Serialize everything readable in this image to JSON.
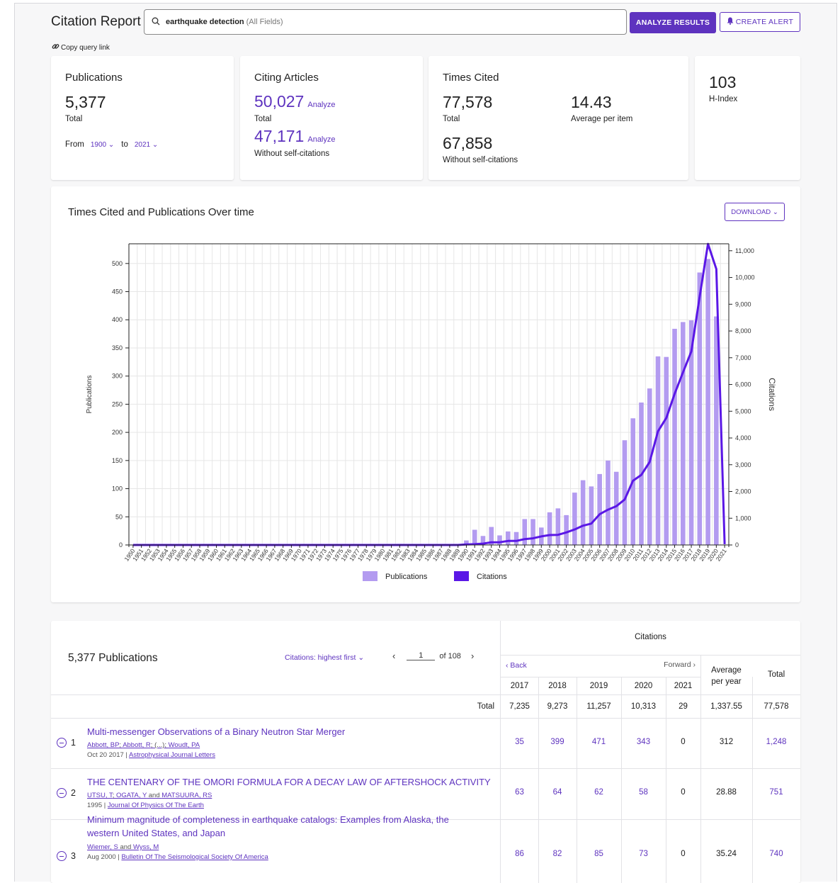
{
  "header": {
    "title": "Citation Report",
    "query": "earthquake detection",
    "field": "(All Fields)",
    "analyze_label": "ANALYZE RESULTS",
    "alert_label": "CREATE ALERT",
    "copy_link_label": "Copy query link"
  },
  "metrics": {
    "publications": {
      "title": "Publications",
      "value": "5,377",
      "sub": "Total",
      "from_label": "From",
      "from": "1900",
      "to_label": "to",
      "to": "2021"
    },
    "citing": {
      "title": "Citing Articles",
      "total": "50,027",
      "total_sub": "Total",
      "without": "47,171",
      "without_sub": "Without self-citations",
      "analyze": "Analyze"
    },
    "times_cited": {
      "title": "Times Cited",
      "total": "77,578",
      "total_sub": "Total",
      "avg": "14.43",
      "avg_sub": "Average per item",
      "without": "67,858",
      "without_sub": "Without self-citations"
    },
    "hindex": {
      "value": "103",
      "label": "H-Index"
    }
  },
  "chart": {
    "title": "Times Cited and Publications Over time",
    "download_label": "DOWNLOAD",
    "legend_pub": "Publications",
    "legend_cit": "Citations"
  },
  "chart_data": {
    "type": "bar",
    "title": "Times Cited and Publications Over time",
    "ylabel": "Publications",
    "y2label": "Citations",
    "ylim": [
      0,
      535
    ],
    "y2lim": [
      0,
      11260
    ],
    "yticks": [
      0,
      50,
      100,
      150,
      200,
      250,
      300,
      350,
      400,
      450,
      500
    ],
    "y2ticks": [
      0,
      1000,
      2000,
      3000,
      4000,
      5000,
      6000,
      7000,
      8000,
      9000,
      10000,
      11000
    ],
    "y2tick_labels": [
      "0",
      "1,000",
      "2,000",
      "3,000",
      "4,000",
      "5,000",
      "6,000",
      "7,000",
      "8,000",
      "9,000",
      "10,000",
      "11,000"
    ],
    "categories": [
      "1950",
      "1951",
      "1952",
      "1953",
      "1954",
      "1955",
      "1956",
      "1957",
      "1958",
      "1959",
      "1960",
      "1961",
      "1962",
      "1963",
      "1964",
      "1965",
      "1966",
      "1967",
      "1968",
      "1969",
      "1970",
      "1971",
      "1972",
      "1973",
      "1974",
      "1975",
      "1976",
      "1977",
      "1978",
      "1979",
      "1980",
      "1981",
      "1982",
      "1983",
      "1984",
      "1985",
      "1986",
      "1987",
      "1988",
      "1989",
      "1990",
      "1991",
      "1992",
      "1993",
      "1994",
      "1995",
      "1996",
      "1997",
      "1998",
      "1999",
      "2000",
      "2001",
      "2002",
      "2003",
      "2004",
      "2005",
      "2006",
      "2007",
      "2008",
      "2009",
      "2010",
      "2011",
      "2012",
      "2013",
      "2014",
      "2015",
      "2016",
      "2017",
      "2018",
      "2019",
      "2020",
      "2021"
    ],
    "series": [
      {
        "name": "Publications",
        "type": "bar",
        "axis": "left",
        "values": [
          0,
          0,
          0,
          0,
          0,
          0,
          0,
          0,
          0,
          0,
          0,
          0,
          0,
          1,
          0,
          0,
          0,
          0,
          0,
          0,
          0,
          1,
          0,
          0,
          0,
          0,
          0,
          0,
          0,
          0,
          1,
          0,
          2,
          0,
          0,
          0,
          0,
          1,
          0,
          1,
          8,
          27,
          16,
          32,
          17,
          24,
          23,
          46,
          46,
          31,
          58,
          65,
          53,
          93,
          115,
          104,
          126,
          150,
          130,
          186,
          225,
          253,
          278,
          335,
          334,
          384,
          396,
          399,
          484,
          508,
          406,
          0
        ]
      },
      {
        "name": "Citations",
        "type": "line",
        "axis": "right",
        "values": [
          0,
          0,
          0,
          0,
          0,
          0,
          0,
          0,
          0,
          0,
          0,
          0,
          0,
          0,
          0,
          0,
          0,
          0,
          0,
          0,
          0,
          0,
          0,
          0,
          0,
          0,
          0,
          0,
          0,
          0,
          0,
          0,
          0,
          0,
          0,
          0,
          0,
          0,
          0,
          0,
          20,
          30,
          50,
          100,
          100,
          150,
          150,
          220,
          250,
          320,
          370,
          380,
          470,
          580,
          720,
          800,
          1150,
          1320,
          1450,
          1700,
          2400,
          2620,
          3100,
          4250,
          4750,
          5650,
          6450,
          7235,
          9273,
          11257,
          10313,
          29
        ]
      }
    ],
    "legend": "bottom",
    "grid": true
  },
  "table": {
    "title": "5,377 Publications",
    "sort_label": "Citations: highest first",
    "page": "1",
    "of_pages": "of 108",
    "citations_header": "Citations",
    "back_label": "Back",
    "forward_label": "Forward",
    "years": [
      "2017",
      "2018",
      "2019",
      "2020",
      "2021"
    ],
    "avg_header_1": "Average",
    "avg_header_2": "per year",
    "total_header": "Total",
    "totals_label": "Total",
    "totals": [
      "7,235",
      "9,273",
      "11,257",
      "10,313",
      "29",
      "1,337.55",
      "77,578"
    ],
    "rows": [
      {
        "num": "1",
        "title": "Multi-messenger Observations of a Binary Neutron Star Merger",
        "title2": "",
        "authors": [
          "Abbott, BP",
          "; ",
          "Abbott, R",
          "; (...); ",
          "Woudt, PA"
        ],
        "date": "Oct 20 2017",
        "journal": "Astrophysical Journal Letters",
        "cites": [
          "35",
          "399",
          "471",
          "343",
          "0"
        ],
        "avg": "312",
        "total": "1,248"
      },
      {
        "num": "2",
        "title": "THE CENTENARY OF THE OMORI FORMULA FOR A DECAY LAW OF AFTERSHOCK ACTIVITY",
        "title2": "",
        "authors": [
          "UTSU, T",
          "; ",
          "OGATA, Y",
          " and ",
          "MATSUURA, RS"
        ],
        "date": "1995",
        "journal": "Journal Of Physics Of The Earth",
        "cites": [
          "63",
          "64",
          "62",
          "58",
          "0"
        ],
        "avg": "28.88",
        "total": "751"
      },
      {
        "num": "3",
        "title": "Minimum magnitude of completeness in earthquake catalogs: Examples from Alaska, the",
        "title2": "western United States, and Japan",
        "authors": [
          "Wiemer, S",
          " and ",
          "Wyss, M"
        ],
        "date": "Aug 2000",
        "journal": "Bulletin Of The Seismological Society Of America",
        "cites": [
          "86",
          "82",
          "85",
          "73",
          "0"
        ],
        "avg": "35.24",
        "total": "740"
      }
    ]
  },
  "colors": {
    "accent": "#5e33bf",
    "bar": "#b39bf0",
    "line": "#5a17e6"
  }
}
